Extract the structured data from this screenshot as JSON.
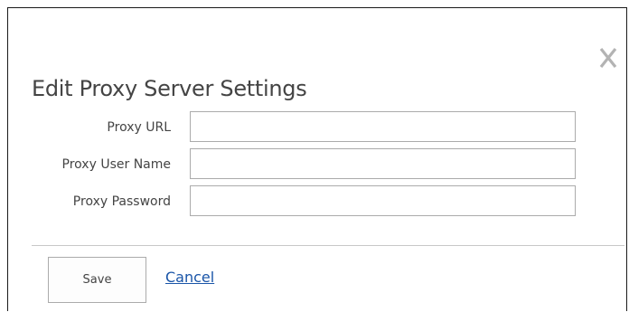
{
  "dialog": {
    "title": "Edit Proxy Server Settings",
    "close_icon": "close-x-icon"
  },
  "form": {
    "fields": [
      {
        "label": "Proxy URL",
        "value": "",
        "placeholder": ""
      },
      {
        "label": "Proxy User Name",
        "value": "",
        "placeholder": ""
      },
      {
        "label": "Proxy Password",
        "value": "",
        "placeholder": ""
      }
    ]
  },
  "actions": {
    "save_label": "Save",
    "cancel_label": "Cancel"
  },
  "colors": {
    "text": "#444444",
    "link": "#1a55a8",
    "border": "#ababab",
    "close_icon": "#b3b3b3"
  }
}
